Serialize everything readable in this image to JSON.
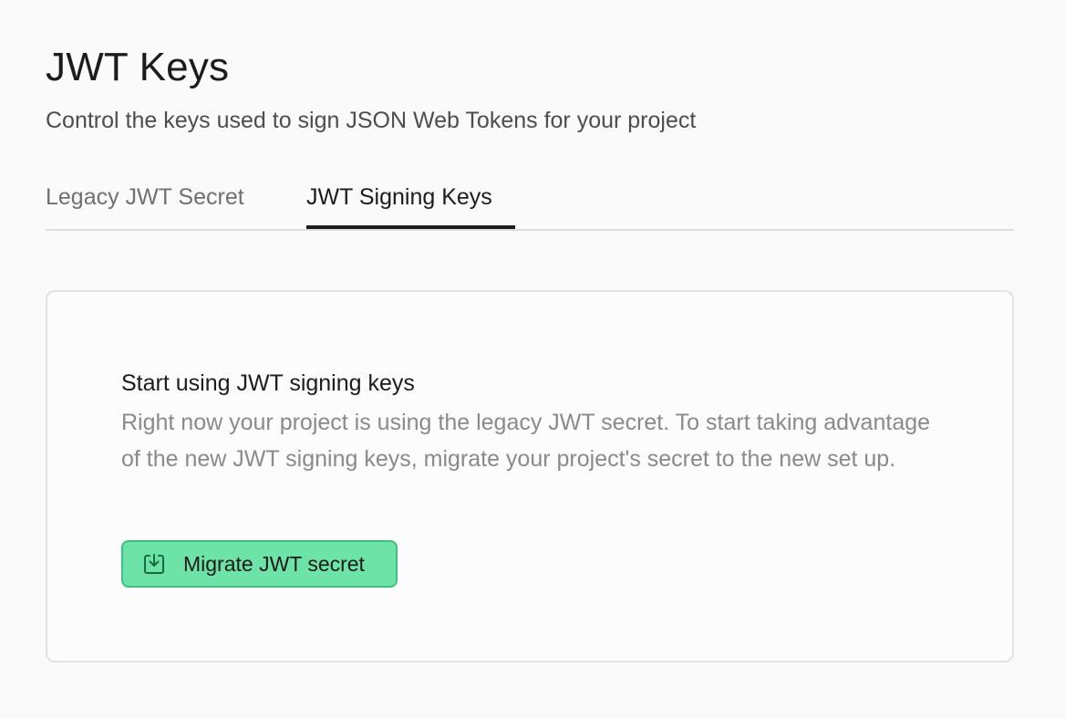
{
  "header": {
    "title": "JWT Keys",
    "subtitle": "Control the keys used to sign JSON Web Tokens for your project"
  },
  "tabs": [
    {
      "label": "Legacy JWT Secret",
      "active": false
    },
    {
      "label": "JWT Signing Keys",
      "active": true
    }
  ],
  "card": {
    "title": "Start using JWT signing keys",
    "body": "Right now your project is using the legacy JWT secret. To start taking advantage of the new JWT signing keys, migrate your project's secret to the new set up.",
    "button_label": "Migrate JWT secret",
    "button_icon": "download-box-icon"
  },
  "colors": {
    "background": "#fafafa",
    "accent": "#6ee3a8",
    "accent_border": "#3dbf7e",
    "text_primary": "#1c1c1c",
    "text_muted": "#8a8a8a"
  }
}
